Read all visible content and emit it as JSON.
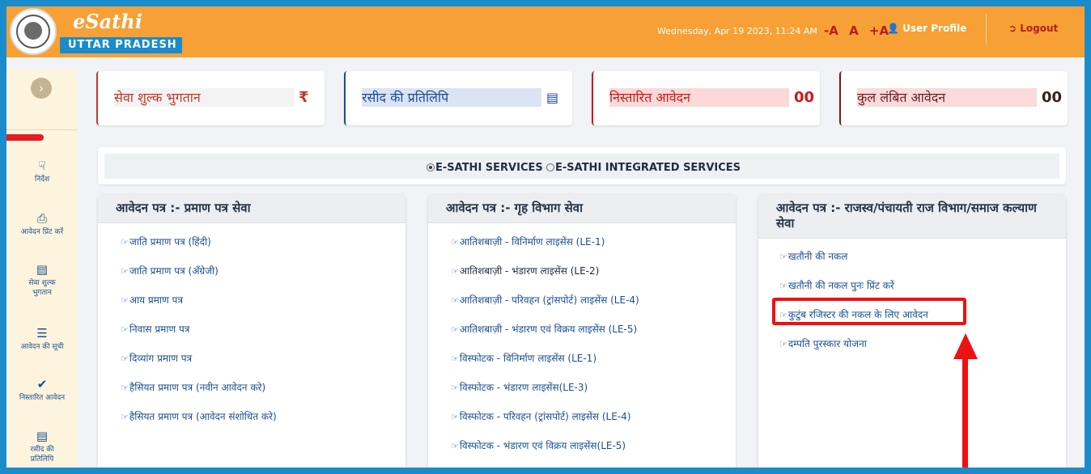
{
  "header": {
    "brand_title": "eSathi",
    "brand_subtitle": "UTTAR  PRADESH",
    "datetime": "Wednesday, Apr 19 2023, 11:24 AM",
    "font_controls": [
      "-A",
      "A",
      "+A"
    ],
    "user_profile_label": "User Profile",
    "logout_label": "Logout"
  },
  "sidebar": {
    "items": [
      {
        "label": "निर्देश",
        "icon": "hand-pointer-icon"
      },
      {
        "label": "आवेदन प्रिंट करें",
        "icon": "print-icon"
      },
      {
        "label": "सेवा शुल्क भुगतान",
        "icon": "credit-card-icon"
      },
      {
        "label": "आवेदन की सूची",
        "icon": "list-icon"
      },
      {
        "label": "निस्तारित आवेदन",
        "icon": "check-icon"
      },
      {
        "label": "रसीद की प्रतिलिपि",
        "icon": "document-icon"
      }
    ]
  },
  "cards": [
    {
      "title": "सेवा शुल्क भुगतान",
      "value": "₹",
      "accent": "#c0392b",
      "bg": "#f3f3f3"
    },
    {
      "title": "रसीद की प्रतिलिपि",
      "value": "▤",
      "accent": "#1a4f8f",
      "bg": "#dbe4f5"
    },
    {
      "title": "निस्तारित आवेदन",
      "value": "00",
      "accent": "#d01818",
      "bg": "#fbd9d9"
    },
    {
      "title": "कुल लंबित आवेदन",
      "value": "00",
      "accent": "#6b1f1f",
      "bg": "#fadada"
    }
  ],
  "services_toggle": {
    "options": [
      {
        "label": "E-SATHI SERVICES",
        "selected": true
      },
      {
        "label": "E-SATHI INTEGRATED SERVICES",
        "selected": false
      }
    ]
  },
  "panels": [
    {
      "title": "आवेदन पत्र :-  प्रमाण पत्र सेवा",
      "links": [
        "जाति प्रमाण पत्र (हिंदी)",
        "जाति प्रमाण पत्र (अँग्रेजी)",
        "आय प्रमाण पत्र",
        "निवास प्रमाण पत्र",
        "दिव्यांग प्रमाण पत्र",
        "हैसियत प्रमाण पत्र (नवीन आवेदन करे)",
        "हैसियत प्रमाण पत्र (आवेदन संशोधित करे)"
      ]
    },
    {
      "title": "आवेदन पत्र :-  गृह विभाग सेवा",
      "links": [
        "आतिशबाज़ी - विनिर्माण लाइसेंस (LE-1)",
        "आतिशबाज़ी - भंडारण लाइसेंस (LE-2)",
        "आतिशबाज़ी - परिवहन (ट्रांसपोर्ट) लाइसेंस (LE-4)",
        "आतिशबाज़ी - भंडारण एवं विक्रय लाइसेंस (LE-5)",
        "विस्फोटक - विनिर्माण लाइसेंस (LE-1)",
        "विस्फोटक - भंडारण लाइसेंस(LE-3)",
        "विस्फोटक - परिवहन (ट्रांसपोर्ट) लाइसेंस (LE-4)",
        "विस्फोटक - भंडारण एवं विक्रय लाइसेंस(LE-5)"
      ]
    },
    {
      "title": "आवेदन पत्र :-  राजस्व/पंचायती राज विभाग/समाज कल्याण सेवा",
      "links": [
        "खतौनी की नकल",
        "खतौनी की नकल पुनः प्रिंट करें",
        "कुटुंब रजिस्टर की नकल के लिए आवेदन",
        "दम्पति पुरस्कार योजना"
      ]
    }
  ]
}
